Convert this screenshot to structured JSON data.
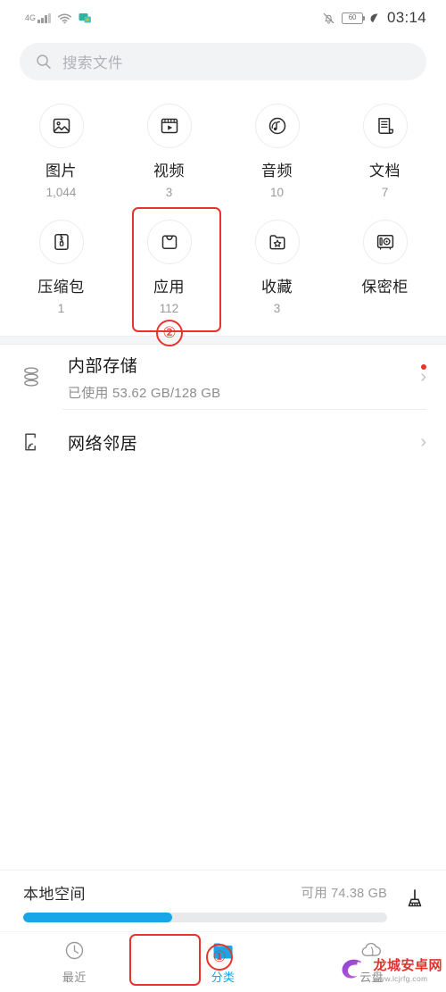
{
  "status_bar": {
    "network_label": "4G",
    "wifi_icon": "wifi-icon",
    "app_icon": "notification-app-icon",
    "mute_icon": "bell-muted-icon",
    "battery_level": "60",
    "power_saving_icon": "leaf-icon",
    "time": "03:14"
  },
  "search": {
    "placeholder": "搜索文件",
    "icon": "search-icon"
  },
  "categories": [
    {
      "label": "图片",
      "count": "1,044",
      "icon": "image-icon",
      "highlighted": false
    },
    {
      "label": "视频",
      "count": "3",
      "icon": "video-icon",
      "highlighted": false
    },
    {
      "label": "音频",
      "count": "10",
      "icon": "audio-icon",
      "highlighted": false
    },
    {
      "label": "文档",
      "count": "7",
      "icon": "document-icon",
      "highlighted": false
    },
    {
      "label": "压缩包",
      "count": "1",
      "icon": "archive-icon",
      "highlighted": false
    },
    {
      "label": "应用",
      "count": "112",
      "icon": "apps-bag-icon",
      "highlighted": true
    },
    {
      "label": "收藏",
      "count": "3",
      "icon": "favorite-folder-icon",
      "highlighted": false
    },
    {
      "label": "保密柜",
      "count": "",
      "icon": "safe-box-icon",
      "highlighted": false
    }
  ],
  "storage_rows": [
    {
      "title": "内部存储",
      "subtitle": "已使用 53.62 GB/128 GB",
      "icon": "internal-storage-icon",
      "chevron": "chevron-right-icon",
      "has_badge": true
    },
    {
      "title": "网络邻居",
      "subtitle": "",
      "icon": "network-neighborhood-icon",
      "chevron": "chevron-right-icon",
      "has_badge": false
    }
  ],
  "local_space": {
    "title": "本地空间",
    "free_text": "可用 74.38 GB",
    "used_percent": 41,
    "clean_icon": "broom-icon",
    "fill_color": "#18a6e8",
    "track_color": "#e8e9ea"
  },
  "bottom_nav": {
    "items": [
      {
        "label": "最近",
        "icon": "clock-icon",
        "active": false
      },
      {
        "label": "分类",
        "icon": "folder-icon",
        "active": true
      },
      {
        "label": "云盘",
        "icon": "cloud-icon",
        "active": false
      }
    ],
    "active_color": "#18a6e8",
    "inactive_color": "#8c8c8c"
  },
  "annotations": [
    {
      "marker": "①",
      "target": "分类",
      "color": "#e8342c"
    },
    {
      "marker": "②",
      "target": "应用",
      "color": "#e8342c"
    }
  ],
  "watermark": {
    "site_name": "龙城安卓网",
    "url": "www.lcjrfg.com"
  }
}
